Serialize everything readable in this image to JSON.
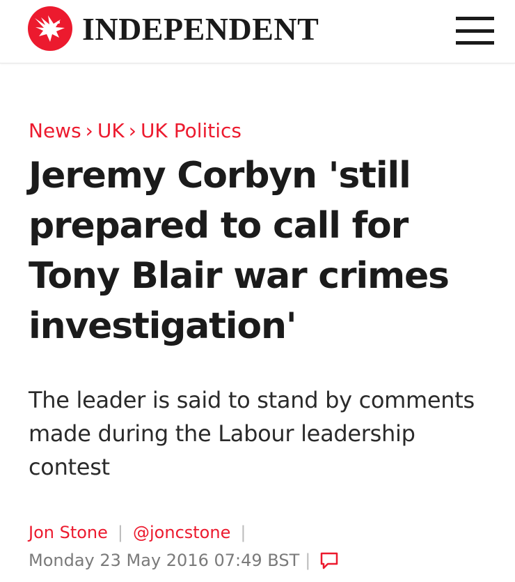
{
  "header": {
    "brand": "INDEPENDENT",
    "logo_icon": "eagle-icon",
    "menu_icon": "hamburger-menu-icon"
  },
  "breadcrumb": {
    "items": [
      "News",
      "UK",
      "UK Politics"
    ],
    "separator": "›"
  },
  "article": {
    "headline": "Jeremy Corbyn 'still prepared to call for Tony Blair war crimes investigation'",
    "standfirst": "The leader is said to stand by comments made during the Labour leadership contest",
    "author": "Jon Stone",
    "twitter_handle": "@joncstone",
    "published": "Monday 23 May 2016 07:49 BST",
    "separator": "|",
    "comment_icon": "comment-icon"
  },
  "colors": {
    "accent": "#ec1a2e",
    "text": "#1b1b1b",
    "muted": "#7a7a7a"
  }
}
